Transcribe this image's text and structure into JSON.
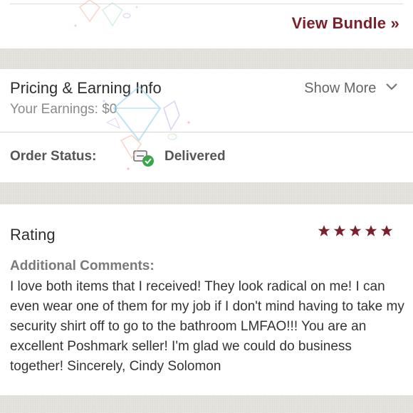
{
  "bundle": {
    "link_label": "View Bundle »"
  },
  "pricing": {
    "title": "Pricing & Earning Info",
    "earnings_label": "Your Earnings: $",
    "earnings_value": "0",
    "show_more_label": "Show More"
  },
  "order": {
    "status_label": "Order Status:",
    "status_value": "Delivered",
    "status_icon": "delivered-check-icon"
  },
  "rating": {
    "title": "Rating",
    "stars": 5,
    "star_color": "#7a1f2b",
    "comments_label": "Additional Comments:",
    "comment": "I love both items that I received! They look radical on me! I can even wear one of them for my job if I don't mind having to take my security shirt off to go to the bathroom LMFAO!!! You are an excellent Poshmark seller! I'm glad we could do business together! Sincerely, Cindy Solomon"
  },
  "colors": {
    "brand": "#7a1f2b",
    "success": "#3aa64c",
    "background": "#e8e6e1"
  }
}
